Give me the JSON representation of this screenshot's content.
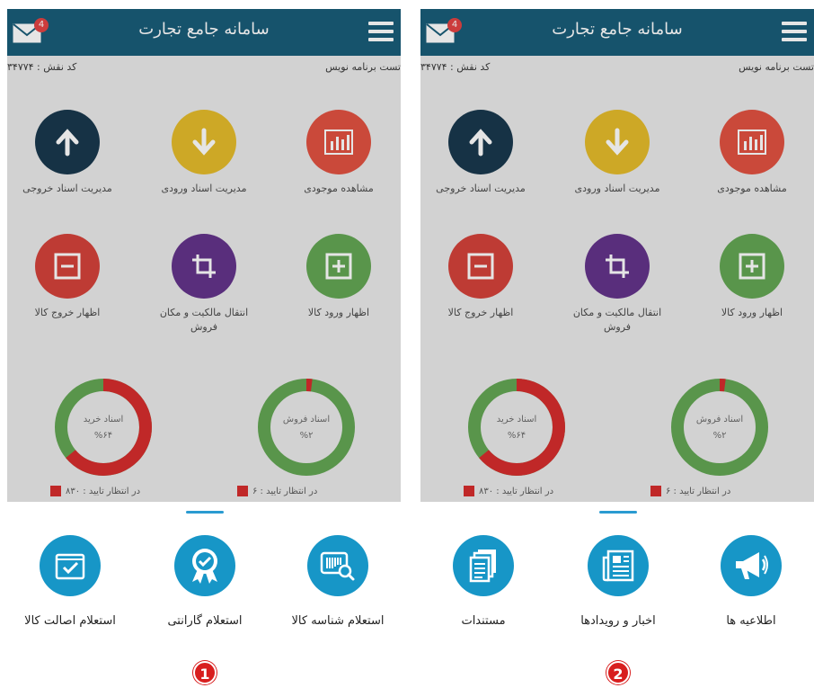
{
  "colors": {
    "header": "#0f5573",
    "accent": "#1796c7",
    "red": "#d42424",
    "green": "#5ca24c",
    "navy": "#0f2f45",
    "yellow": "#e3b821",
    "purple": "#5c2a85"
  },
  "panels": [
    {
      "header": {
        "title": "سامانه جامع تجارت",
        "mail_badge": "4"
      },
      "user_name": "تست برنامه نویس",
      "role_code": "کد نقش : ۳۴۷۷۴",
      "tiles": [
        {
          "label": "مشاهده موجودی",
          "icon": "bar-chart-icon"
        },
        {
          "label": "مدیریت اسناد ورودی",
          "icon": "arrow-down-icon"
        },
        {
          "label": "مدیریت اسناد خروجی",
          "icon": "arrow-up-icon"
        },
        {
          "label": "اظهار ورود کالا",
          "icon": "plus-box-icon"
        },
        {
          "label": "انتقال مالکیت و مکان فروش",
          "icon": "crop-icon"
        },
        {
          "label": "اظهار خروج کالا",
          "icon": "minus-box-icon"
        }
      ],
      "donuts": [
        {
          "title": "اسناد فروش",
          "percent_label": "%۲",
          "pending": "در انتظار تایید : ۶",
          "red_fraction": 0.02
        },
        {
          "title": "اسناد خرید",
          "percent_label": "%۶۴",
          "pending": "در انتظار تایید : ۸۳۰",
          "red_fraction": 0.64
        }
      ],
      "actions": [
        {
          "label": "استعلام شناسه کالا",
          "icon": "barcode-search-icon"
        },
        {
          "label": "استعلام گارانتی",
          "icon": "warranty-badge-icon"
        },
        {
          "label": "استعلام اصالت کالا",
          "icon": "checked-box-icon"
        }
      ],
      "step": "1"
    },
    {
      "header": {
        "title": "سامانه جامع تجارت",
        "mail_badge": "4"
      },
      "user_name": "تست برنامه نویس",
      "role_code": "کد نقش : ۳۴۷۷۴",
      "tiles": [
        {
          "label": "مشاهده موجودی",
          "icon": "bar-chart-icon"
        },
        {
          "label": "مدیریت اسناد ورودی",
          "icon": "arrow-down-icon"
        },
        {
          "label": "مدیریت اسناد خروجی",
          "icon": "arrow-up-icon"
        },
        {
          "label": "اظهار ورود کالا",
          "icon": "plus-box-icon"
        },
        {
          "label": "انتقال مالکیت و مکان فروش",
          "icon": "crop-icon"
        },
        {
          "label": "اظهار خروج کالا",
          "icon": "minus-box-icon"
        }
      ],
      "donuts": [
        {
          "title": "اسناد فروش",
          "percent_label": "%۲",
          "pending": "در انتظار تایید : ۶",
          "red_fraction": 0.02
        },
        {
          "title": "اسناد خرید",
          "percent_label": "%۶۴",
          "pending": "در انتظار تایید : ۸۳۰",
          "red_fraction": 0.64
        }
      ],
      "actions": [
        {
          "label": "اطلاعیه ها",
          "icon": "megaphone-icon"
        },
        {
          "label": "اخبار و رویدادها",
          "icon": "newspaper-icon"
        },
        {
          "label": "مستندات",
          "icon": "documents-icon"
        }
      ],
      "step": "2"
    }
  ]
}
